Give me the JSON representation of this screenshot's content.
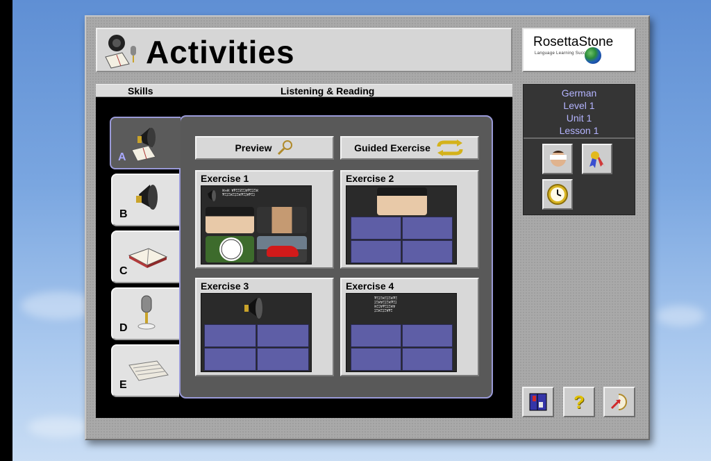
{
  "app": {
    "title": "Activities",
    "brand": "RosettaStone",
    "brand_tagline": "Language Learning   Success"
  },
  "header": {
    "skills_label": "Skills",
    "mode_label": "Listening & Reading"
  },
  "tabs": [
    {
      "letter": "A",
      "icon": "speaker-book-icon",
      "active": true
    },
    {
      "letter": "B",
      "icon": "speaker-icon",
      "active": false
    },
    {
      "letter": "C",
      "icon": "book-icon",
      "active": false
    },
    {
      "letter": "D",
      "icon": "microphone-icon",
      "active": false
    },
    {
      "letter": "E",
      "icon": "keyboard-icon",
      "active": false
    }
  ],
  "buttons": {
    "preview": "Preview",
    "guided": "Guided Exercise"
  },
  "exercises": [
    {
      "title": "Exercise 1"
    },
    {
      "title": "Exercise 2"
    },
    {
      "title": "Exercise 3"
    },
    {
      "title": "Exercise 4"
    }
  ],
  "course": {
    "language": "German",
    "level": "Level 1",
    "unit": "Unit 1",
    "lesson": "Lesson 1"
  },
  "tools": {
    "help_label": "?"
  },
  "colors": {
    "accent": "#9a9ad8",
    "info_text": "#b4b4ff",
    "panel": "#595959"
  }
}
